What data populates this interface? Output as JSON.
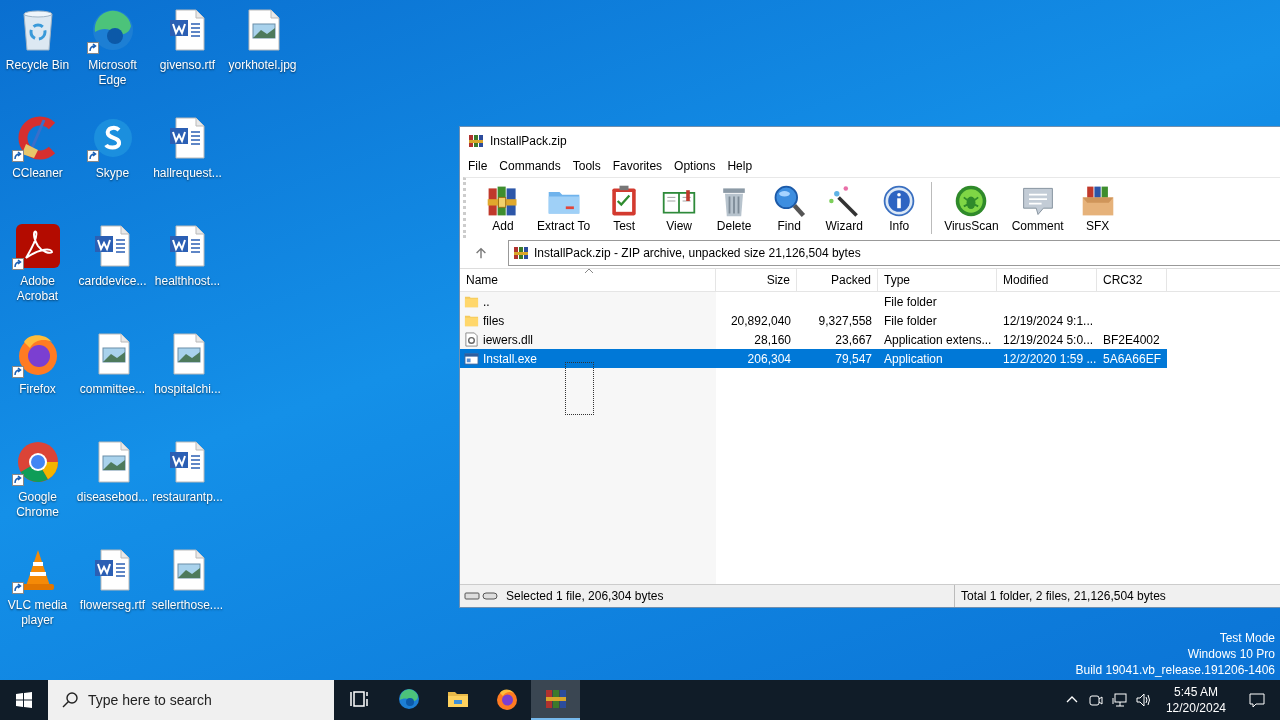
{
  "desktop_icons": [
    {
      "label": "Recycle Bin",
      "kind": "recycle",
      "shortcut": false
    },
    {
      "label": "CCleaner",
      "kind": "ccleaner",
      "shortcut": true
    },
    {
      "label": "Adobe Acrobat",
      "kind": "acrobat",
      "shortcut": true
    },
    {
      "label": "Firefox",
      "kind": "firefox",
      "shortcut": true
    },
    {
      "label": "Google Chrome",
      "kind": "chrome",
      "shortcut": true
    },
    {
      "label": "VLC media player",
      "kind": "vlc",
      "shortcut": true
    },
    {
      "label": "Microsoft Edge",
      "kind": "edge",
      "shortcut": true
    },
    {
      "label": "Skype",
      "kind": "skype",
      "shortcut": true
    },
    {
      "label": "carddevice...",
      "kind": "word",
      "shortcut": false
    },
    {
      "label": "committee...",
      "kind": "image",
      "shortcut": false
    },
    {
      "label": "diseasebod...",
      "kind": "image",
      "shortcut": false
    },
    {
      "label": "flowerseg.rtf",
      "kind": "word",
      "shortcut": false
    },
    {
      "label": "givenso.rtf",
      "kind": "word",
      "shortcut": false
    },
    {
      "label": "hallrequest...",
      "kind": "word",
      "shortcut": false
    },
    {
      "label": "healthhost...",
      "kind": "word",
      "shortcut": false
    },
    {
      "label": "hospitalchi...",
      "kind": "image",
      "shortcut": false
    },
    {
      "label": "restaurantp...",
      "kind": "word",
      "shortcut": false
    },
    {
      "label": "sellerthose....",
      "kind": "image",
      "shortcut": false
    },
    {
      "label": "yorkhotel.jpg",
      "kind": "image",
      "shortcut": false
    }
  ],
  "window": {
    "title": "InstallPack.zip",
    "menu": [
      "File",
      "Commands",
      "Tools",
      "Favorites",
      "Options",
      "Help"
    ],
    "toolbar_groups": [
      {
        "buttons": [
          {
            "label": "Add",
            "kind": "add"
          },
          {
            "label": "Extract To",
            "kind": "extract"
          },
          {
            "label": "Test",
            "kind": "test"
          },
          {
            "label": "View",
            "kind": "view"
          },
          {
            "label": "Delete",
            "kind": "delete"
          },
          {
            "label": "Find",
            "kind": "find"
          },
          {
            "label": "Wizard",
            "kind": "wizard"
          },
          {
            "label": "Info",
            "kind": "info"
          }
        ]
      },
      {
        "buttons": [
          {
            "label": "VirusScan",
            "kind": "virusscan"
          },
          {
            "label": "Comment",
            "kind": "comment"
          },
          {
            "label": "SFX",
            "kind": "sfx"
          }
        ]
      }
    ],
    "address": "InstallPack.zip - ZIP archive, unpacked size 21,126,504 bytes",
    "columns": [
      {
        "label": "Name",
        "sorted": true
      },
      {
        "label": "Size",
        "sorted": false
      },
      {
        "label": "Packed",
        "sorted": false
      },
      {
        "label": "Type",
        "sorted": false
      },
      {
        "label": "Modified",
        "sorted": false
      },
      {
        "label": "CRC32",
        "sorted": false
      }
    ],
    "rows": [
      {
        "name": "..",
        "kind": "folder",
        "type": "File folder",
        "selected": false
      },
      {
        "name": "files",
        "kind": "folder",
        "size": "20,892,040",
        "packed": "9,327,558",
        "type": "File folder",
        "modified": "12/19/2024 9:1...",
        "selected": false
      },
      {
        "name": "iewers.dll",
        "kind": "dll",
        "size": "28,160",
        "packed": "23,667",
        "type": "Application extens...",
        "modified": "12/19/2024 5:0...",
        "crc32": "BF2E4002",
        "selected": false
      },
      {
        "name": "Install.exe",
        "kind": "exe",
        "size": "206,304",
        "packed": "79,547",
        "type": "Application",
        "modified": "12/2/2020 1:59 ...",
        "crc32": "5A6A66EF",
        "selected": true
      }
    ],
    "status_left": "Selected 1 file, 206,304 bytes",
    "status_right": "Total 1 folder, 2 files, 21,126,504 bytes"
  },
  "desktop_notice": [
    "Test Mode",
    "Windows 10 Pro",
    "Build 19041.vb_release.191206-1406"
  ],
  "taskbar": {
    "search_placeholder": "Type here to search",
    "apps": [
      {
        "kind": "taskview",
        "active": false
      },
      {
        "kind": "edge",
        "active": false
      },
      {
        "kind": "explorer",
        "active": false
      },
      {
        "kind": "firefox",
        "active": false
      },
      {
        "kind": "winrar",
        "active": true
      }
    ],
    "time": "5:45 AM",
    "date": "12/20/2024"
  }
}
